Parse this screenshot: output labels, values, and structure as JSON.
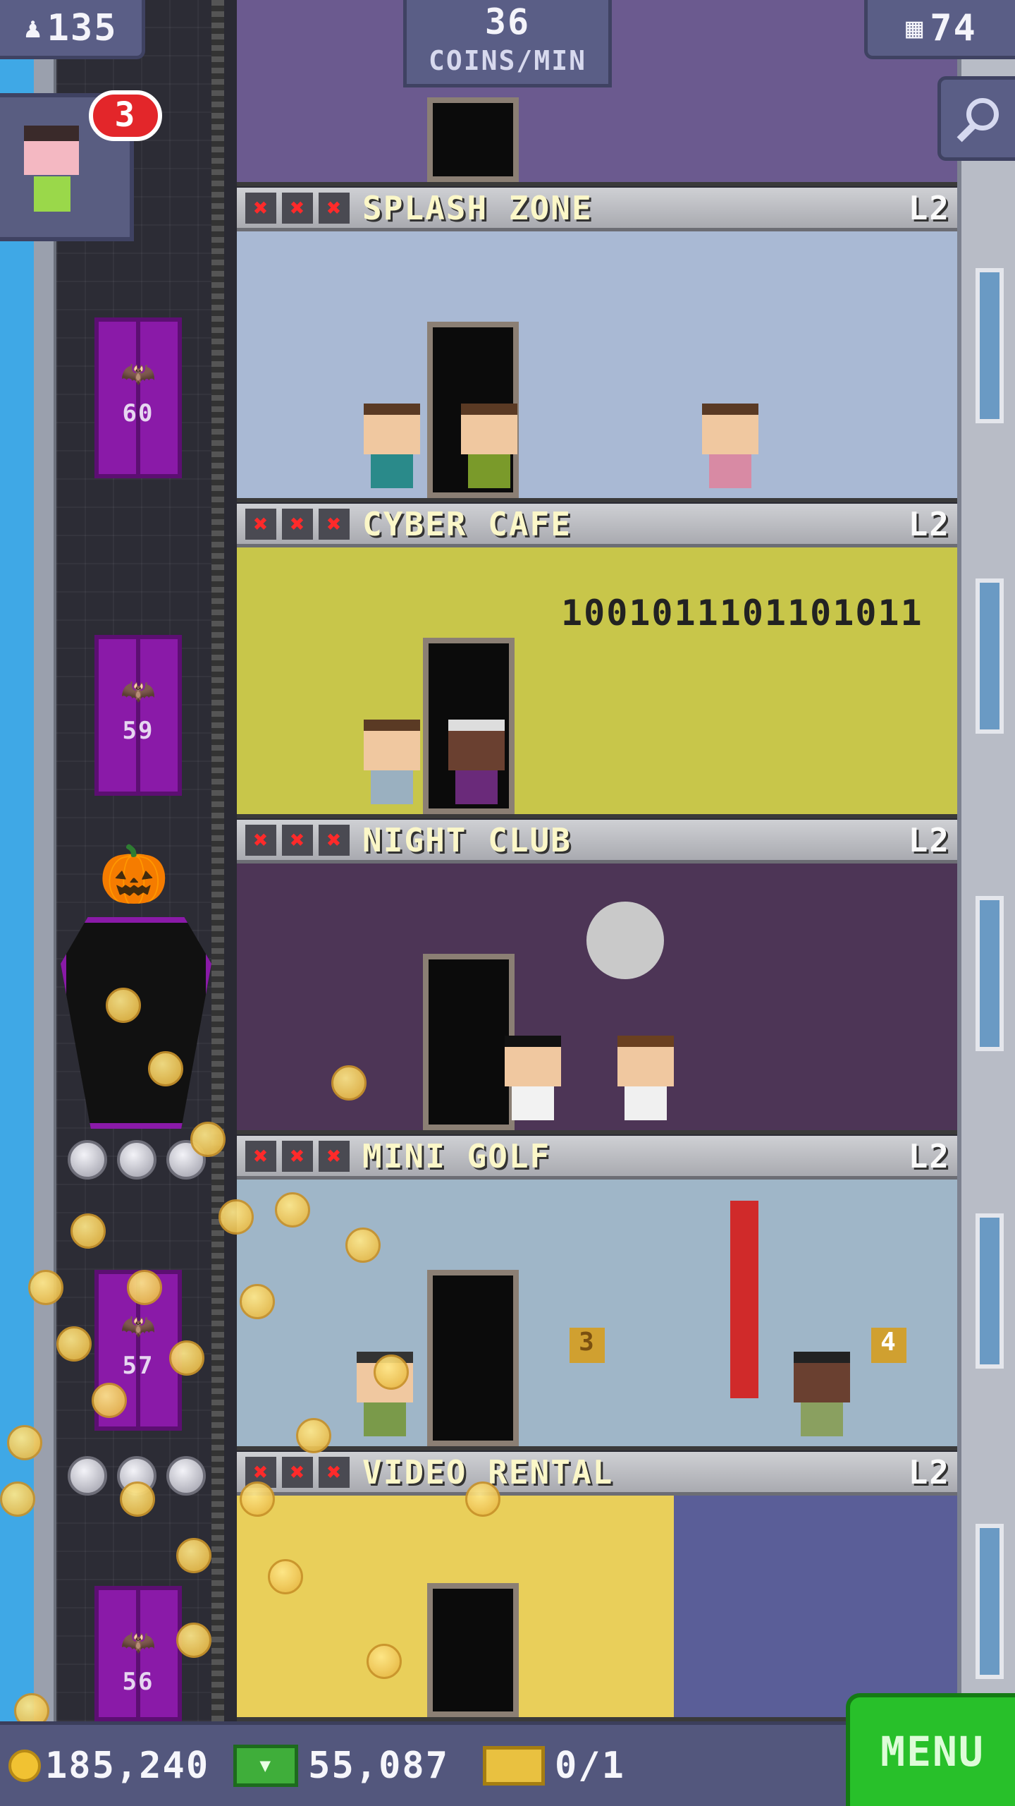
{
  "top_bar": {
    "population": "135",
    "coins_per_min": "36",
    "coins_per_min_label": "COINS/MIN",
    "floors": "74"
  },
  "avatar": {
    "notification_count": "3"
  },
  "icons": [
    "person-icon",
    "building-icon",
    "search-icon",
    "coin-icon",
    "cash-icon",
    "ticket-icon"
  ],
  "elevator": {
    "floor_numbers": [
      "60",
      "59",
      "57",
      "56"
    ]
  },
  "floors": [
    {
      "name": "SPLASH ZONE",
      "level": "L2",
      "color": "#a9b9d4"
    },
    {
      "name": "CYBER CAFE",
      "level": "L2",
      "color": "#c8c64a",
      "binary_text": "1001011101101011"
    },
    {
      "name": "NIGHT CLUB",
      "level": "L2",
      "color": "#4d3556"
    },
    {
      "name": "MINI GOLF",
      "level": "L2",
      "color": "#9fb6c8",
      "hole_numbers": [
        "3",
        "4"
      ]
    },
    {
      "name": "VIDEO RENTAL",
      "level": "L2",
      "color": "#e9cf5a"
    }
  ],
  "bottom_bar": {
    "coins": "185,240",
    "bux": "55,087",
    "tickets": "0/1",
    "menu_label": "MENU"
  },
  "colors": {
    "ui_bar": "#5a5e86",
    "menu_green": "#28c02a",
    "elevator_purple": "#8a1aa8",
    "stock_red": "#ff2a2a"
  }
}
